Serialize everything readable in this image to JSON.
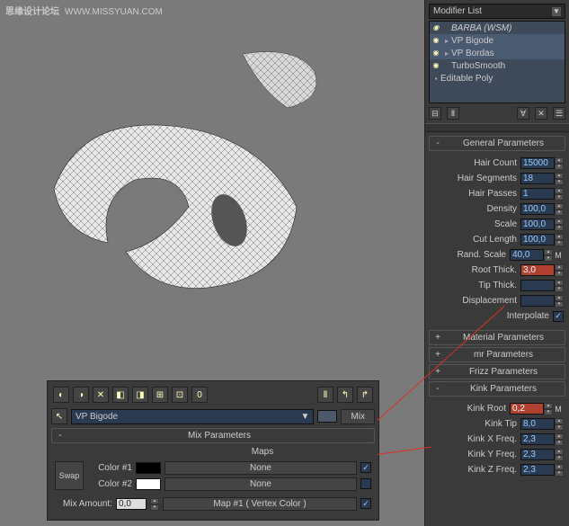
{
  "watermark": {
    "text": "思缘设计论坛",
    "url": "WWW.MISSYUAN.COM"
  },
  "modifier_list_label": "Modifier List",
  "stack_items": [
    {
      "name": "BARBA (WSM)",
      "italic": true
    },
    {
      "name": "VP Bigode"
    },
    {
      "name": "VP Bordas"
    },
    {
      "name": "TurboSmooth"
    },
    {
      "name": "Editable Poly"
    }
  ],
  "rollouts": {
    "general": {
      "title": "General Parameters",
      "params": [
        {
          "label": "Hair Count",
          "value": "15000"
        },
        {
          "label": "Hair Segments",
          "value": "18"
        },
        {
          "label": "Hair Passes",
          "value": "1"
        },
        {
          "label": "Density",
          "value": "100,0"
        },
        {
          "label": "Scale",
          "value": "100,0"
        },
        {
          "label": "Cut Length",
          "value": "100,0"
        },
        {
          "label": "Rand. Scale",
          "value": "40,0",
          "suffix": "M"
        },
        {
          "label": "Root Thick.",
          "value": "3,0",
          "hl": true
        },
        {
          "label": "Tip Thick.",
          "value": ""
        },
        {
          "label": "Displacement",
          "value": ""
        }
      ],
      "interpolate": {
        "label": "Interpolate",
        "checked": true
      }
    },
    "material": {
      "title": "Material Parameters"
    },
    "mr": {
      "title": "mr Parameters"
    },
    "frizz": {
      "title": "Frizz Parameters"
    },
    "kink": {
      "title": "Kink Parameters",
      "params": [
        {
          "label": "Kink Root",
          "value": "0,2",
          "hl": true,
          "suffix": "M"
        },
        {
          "label": "Kink Tip",
          "value": "8,0"
        },
        {
          "label": "Kink X Freq.",
          "value": "2,3"
        },
        {
          "label": "Kink Y Freq.",
          "value": "2,3"
        },
        {
          "label": "Kink Z Freq.",
          "value": "2,3"
        }
      ]
    }
  },
  "bottom": {
    "name_value": "VP Bigode",
    "mix_label": "Mix",
    "mix_title": "Mix Parameters",
    "maps_label": "Maps",
    "swap": "Swap",
    "color1": {
      "label": "Color #1",
      "hex": "#000000",
      "map": "None",
      "checked": true
    },
    "color2": {
      "label": "Color #2",
      "hex": "#ffffff",
      "map": "None",
      "checked": false
    },
    "mix_amount": {
      "label": "Mix Amount:",
      "value": "0,0",
      "map": "Map #1 ( Vertex Color )",
      "checked": true
    }
  }
}
